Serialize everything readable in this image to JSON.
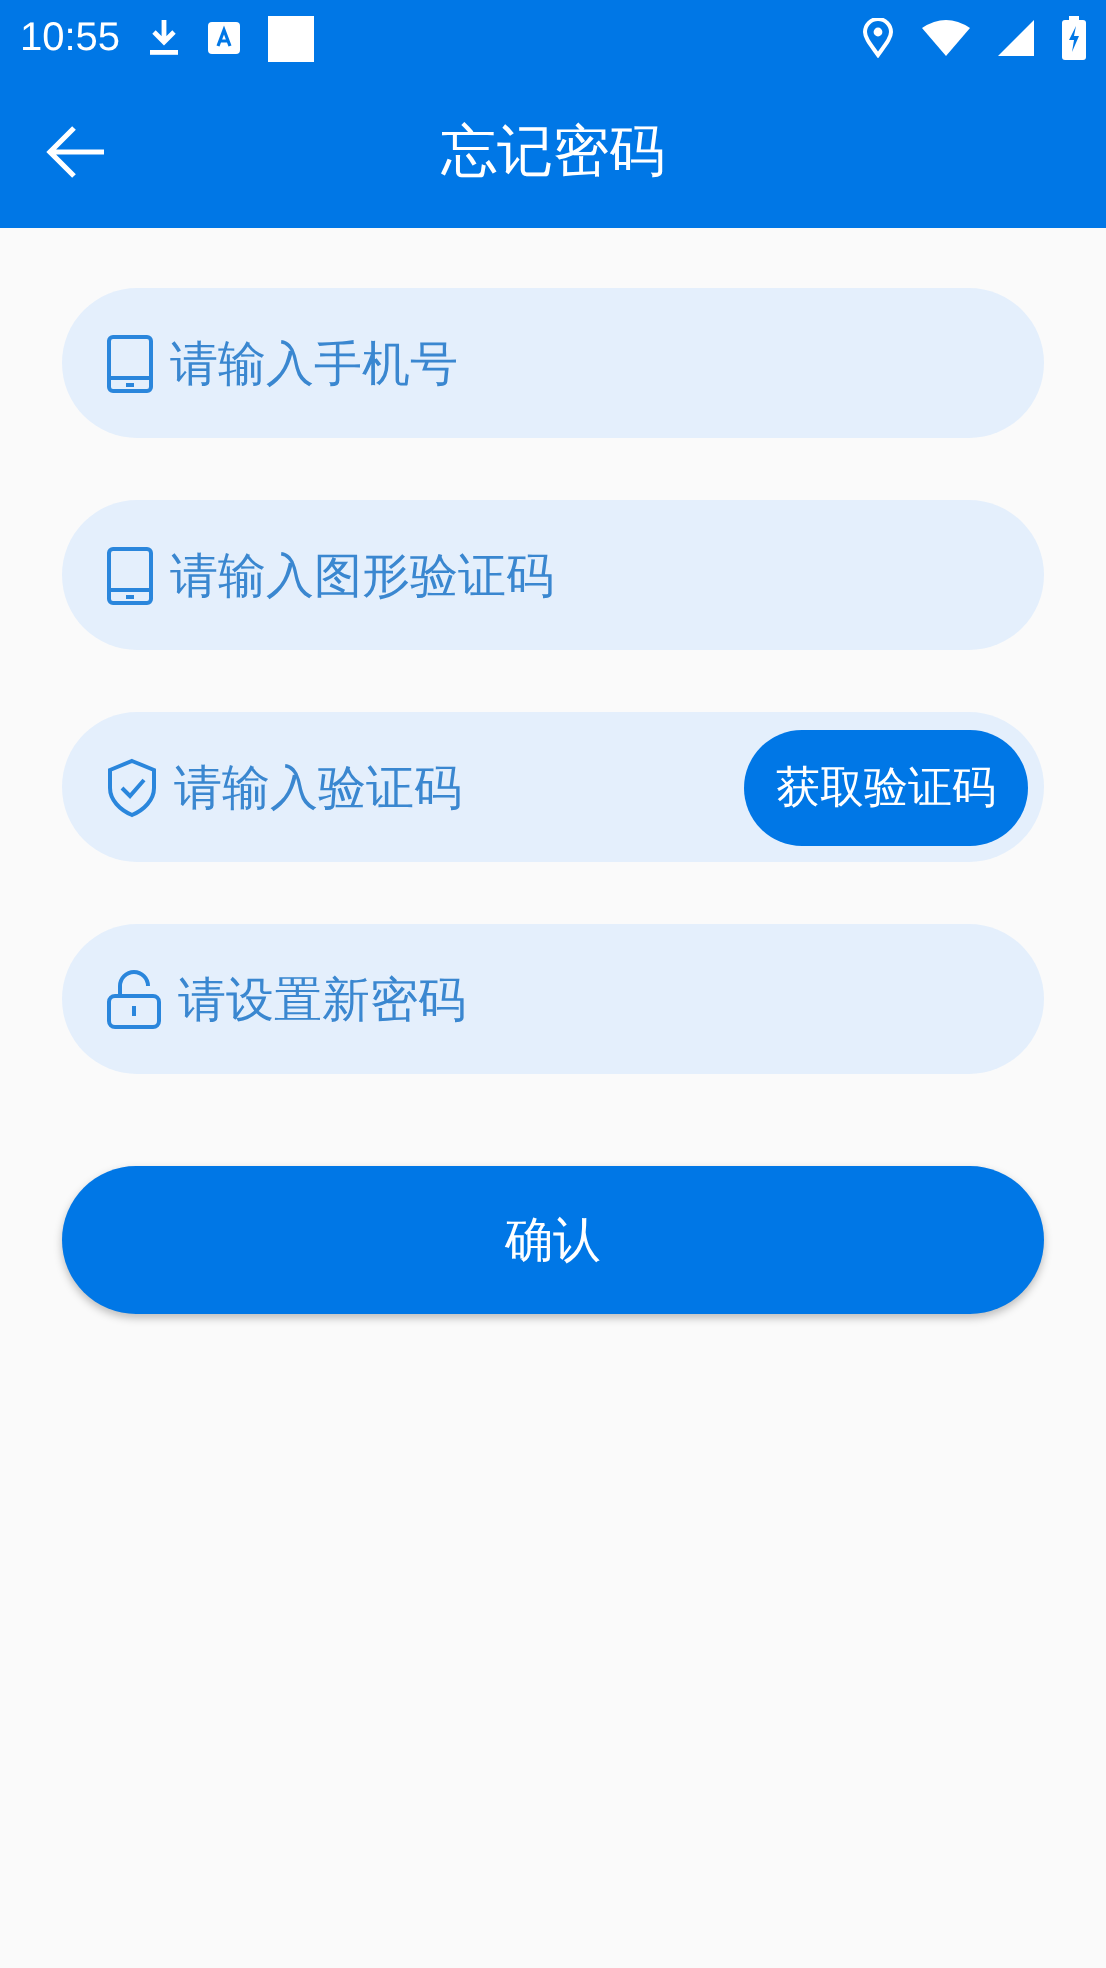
{
  "status_bar": {
    "time": "10:55"
  },
  "app_bar": {
    "title": "忘记密码"
  },
  "fields": [
    {
      "kind": "tablet",
      "placeholder": "请输入手机号"
    },
    {
      "kind": "tablet",
      "placeholder": "请输入图形验证码"
    },
    {
      "kind": "shield",
      "placeholder": "请输入验证码",
      "action": "获取验证码"
    },
    {
      "kind": "lock",
      "placeholder": "请设置新密码"
    }
  ],
  "submit": {
    "label": "确认"
  }
}
